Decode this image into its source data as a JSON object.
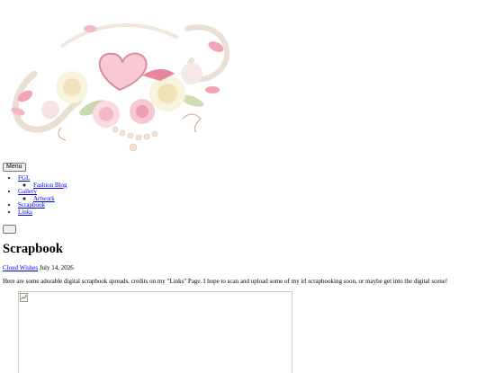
{
  "header": {
    "artwork_alt": "Pink roses and ribbon scrapbook cluster"
  },
  "nav": {
    "menu_label": "Menu",
    "items": [
      {
        "label": "FGL",
        "children": [
          {
            "label": "Fashion Blog"
          }
        ]
      },
      {
        "label": "Gallery",
        "children": [
          {
            "label": "Artwork"
          }
        ]
      },
      {
        "label": "Scrapbook"
      },
      {
        "label": "Links"
      }
    ]
  },
  "post": {
    "title": "Scrapbook",
    "author": "Cloud Wishes",
    "date": "July 14, 2026",
    "intro": "Here are some adorable digital scrapbook spreads, credits on my \"Links\" Page. I hope to scan and upload some of my irl scrapbooking soon, or maybe get into the digital scene!"
  },
  "icons": {
    "search_toggle": "search-icon",
    "broken_image": "broken-image-icon"
  },
  "colors": {
    "link": "#0000ee",
    "petal_pink": "#f4a3b5",
    "rose_cream": "#f6f0d8",
    "ribbon": "#e8dccd"
  }
}
